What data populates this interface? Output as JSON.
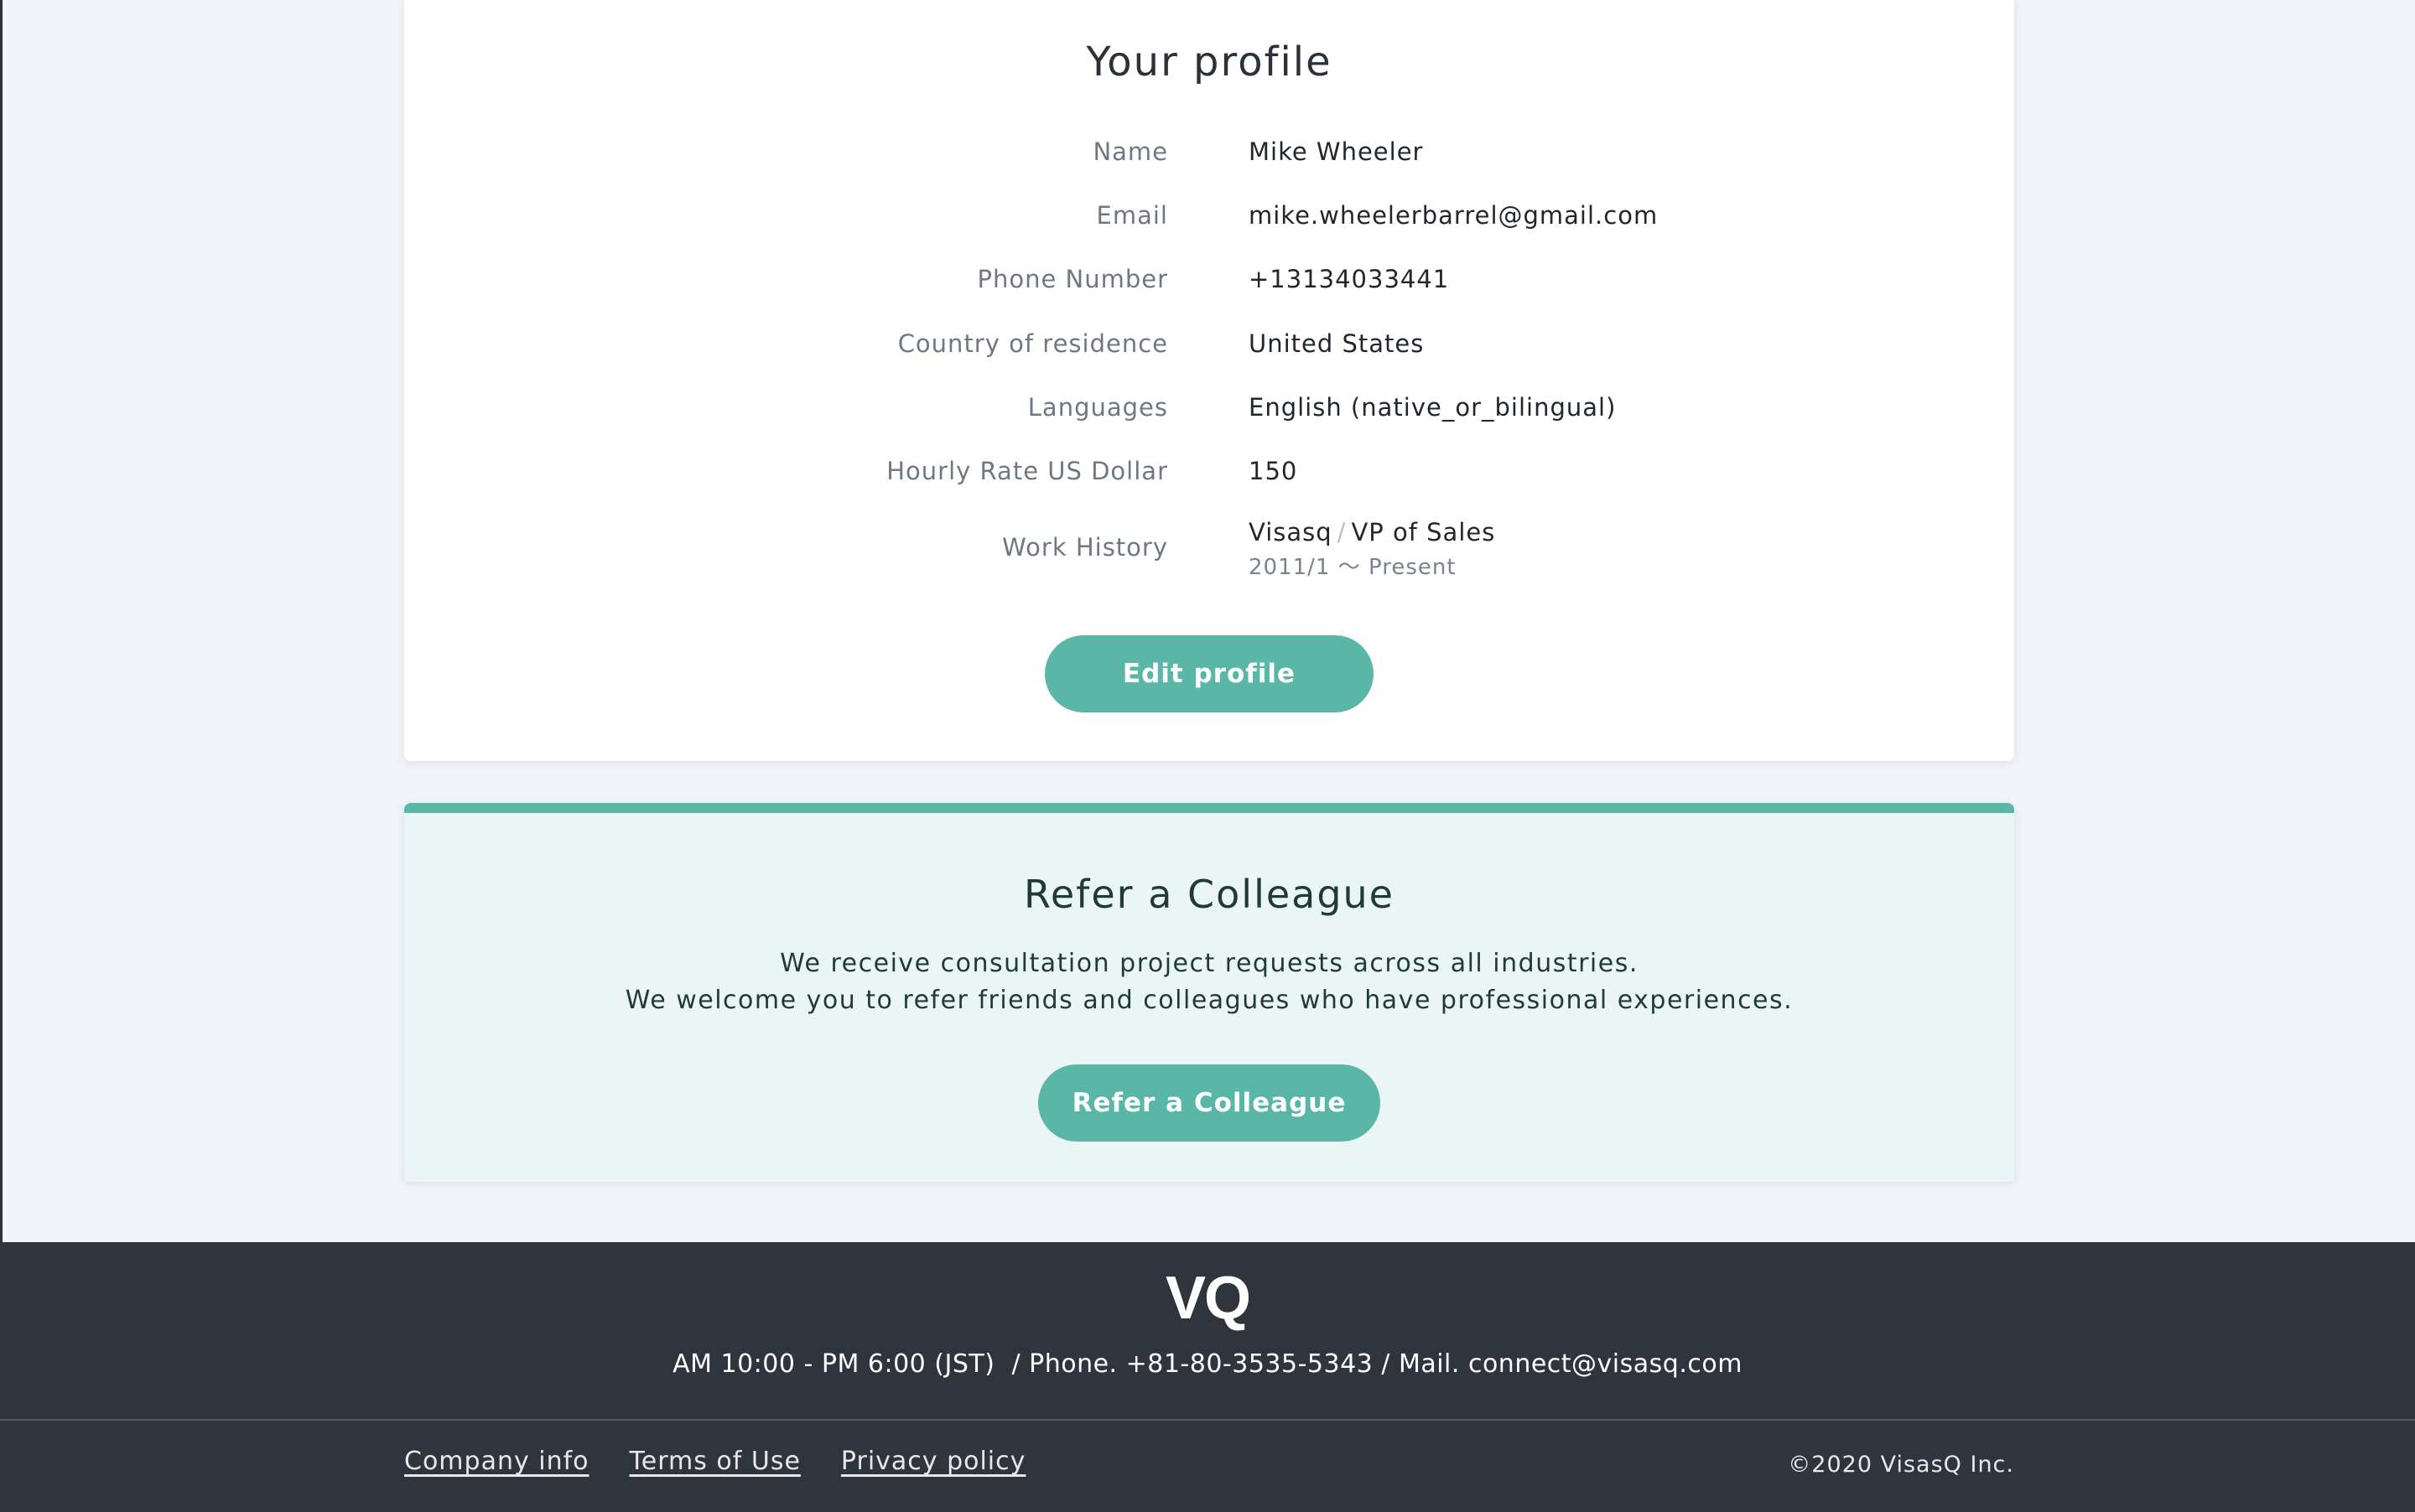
{
  "profile": {
    "title": "Your profile",
    "rows": [
      {
        "label": "Name",
        "value": "Mike Wheeler"
      },
      {
        "label": "Email",
        "value": "mike.wheelerbarrel@gmail.com"
      },
      {
        "label": "Phone Number",
        "value": "+13134033441"
      },
      {
        "label": "Country of residence",
        "value": "United States"
      },
      {
        "label": "Languages",
        "value": "English (native_or_bilingual)"
      },
      {
        "label": "Hourly Rate US Dollar",
        "value": "150"
      }
    ],
    "work_history": {
      "label": "Work History",
      "company": "Visasq",
      "separator": "/",
      "position": "VP of Sales",
      "period": "2011/1 〜 Present"
    },
    "edit_button": "Edit profile"
  },
  "refer": {
    "title": "Refer a Colleague",
    "line1": "We receive consultation project requests across all industries.",
    "line2": "We welcome you to refer friends and colleagues who have professional experiences.",
    "button": "Refer a Colleague"
  },
  "footer": {
    "logo": "VQ",
    "contact": "AM 10:00 - PM 6:00 (JST)  / Phone. +81-80-3535-5343 / Mail. connect@visasq.com",
    "links": [
      "Company info",
      "Terms of Use",
      "Privacy policy"
    ],
    "copyright": "©2020 VisasQ Inc."
  },
  "colors": {
    "accent": "#5ab7a7",
    "footer_bg": "#30343d",
    "page_bg": "#f1f4f8",
    "refer_bg": "#ebf5f3"
  }
}
